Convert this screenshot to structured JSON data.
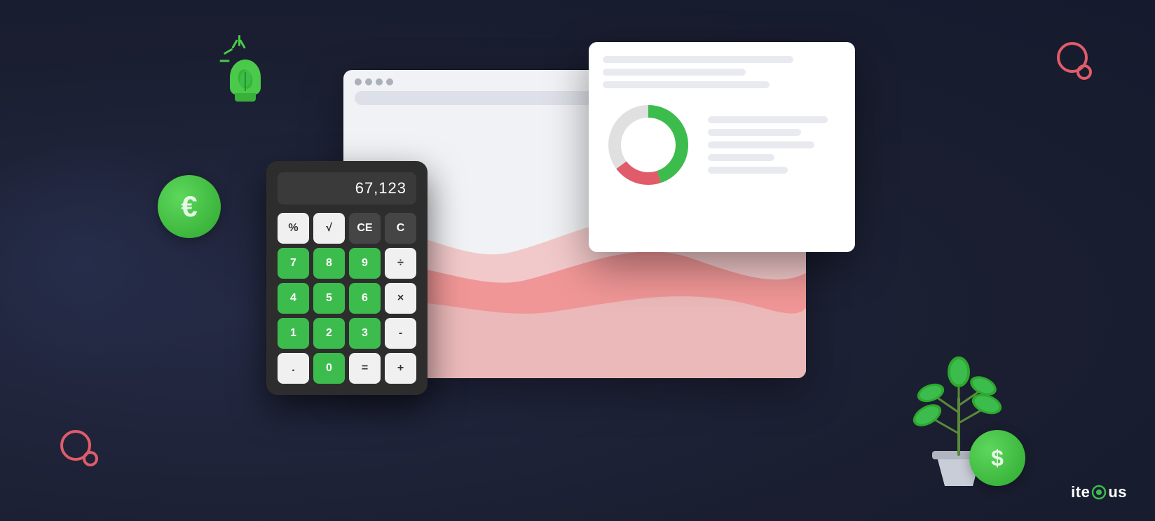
{
  "background": {
    "color": "#1e2235"
  },
  "calculator": {
    "display_value": "67,123",
    "buttons": [
      {
        "label": "%",
        "type": "btn-white"
      },
      {
        "label": "√",
        "type": "btn-white"
      },
      {
        "label": "CE",
        "type": "btn-dark"
      },
      {
        "label": "C",
        "type": "btn-dark"
      },
      {
        "label": "7",
        "type": "btn-green"
      },
      {
        "label": "8",
        "type": "btn-green"
      },
      {
        "label": "9",
        "type": "btn-green"
      },
      {
        "label": "÷",
        "type": "btn-white"
      },
      {
        "label": "4",
        "type": "btn-green"
      },
      {
        "label": "5",
        "type": "btn-green"
      },
      {
        "label": "6",
        "type": "btn-green"
      },
      {
        "label": "×",
        "type": "btn-white"
      },
      {
        "label": "1",
        "type": "btn-green"
      },
      {
        "label": "2",
        "type": "btn-green"
      },
      {
        "label": "3",
        "type": "btn-green"
      },
      {
        "label": "-",
        "type": "btn-white"
      },
      {
        "label": ".",
        "type": "btn-white"
      },
      {
        "label": "0",
        "type": "btn-green"
      },
      {
        "label": "=",
        "type": "btn-white"
      },
      {
        "label": "+",
        "type": "btn-white"
      }
    ]
  },
  "donut": {
    "green_pct": 45,
    "red_pct": 20,
    "gray_pct": 35
  },
  "logo": {
    "text_before": "ite",
    "accent": "◉",
    "text_after": "us",
    "brand_color": "#3dbc4e"
  },
  "euro_coin": {
    "symbol": "€"
  },
  "dollar_coin": {
    "symbol": "$"
  },
  "browser_dots": [
    "•",
    "•",
    "•",
    "•"
  ],
  "decorative": {
    "circles_color": "#e05c6a",
    "green_accent": "#3dbc4e"
  }
}
